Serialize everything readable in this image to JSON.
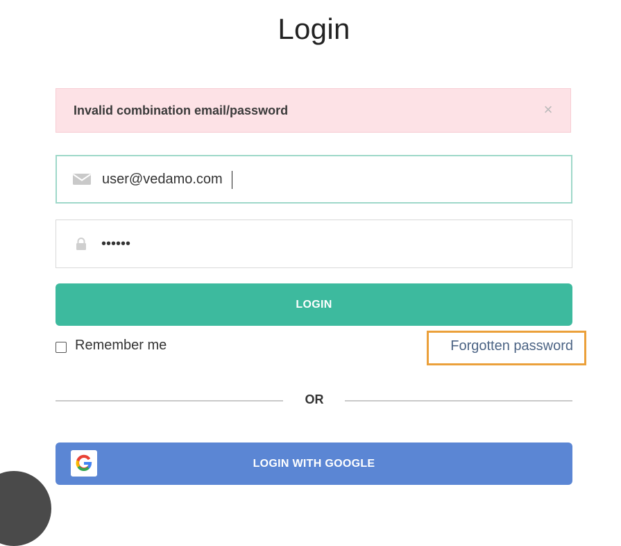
{
  "page": {
    "title": "Login"
  },
  "alert": {
    "message": "Invalid combination email/password",
    "close_symbol": "×",
    "close_icon": "close-icon"
  },
  "email_field": {
    "value": "user@vedamo.com",
    "icon": "envelope-icon"
  },
  "password_field": {
    "value": "••••••",
    "icon": "lock-icon"
  },
  "login_button": {
    "label": "LOGIN"
  },
  "remember": {
    "label": "Remember me",
    "checked": false
  },
  "forgot": {
    "label": "Forgotten password",
    "highlight_color": "#eba03a"
  },
  "divider": {
    "label": "OR"
  },
  "google_button": {
    "label": "LOGIN WITH GOOGLE",
    "icon": "google-icon"
  },
  "colors": {
    "accent": "#3dba9e",
    "google_blue": "#5b86d4",
    "alert_bg": "#fde2e6",
    "link": "#4b6384"
  }
}
